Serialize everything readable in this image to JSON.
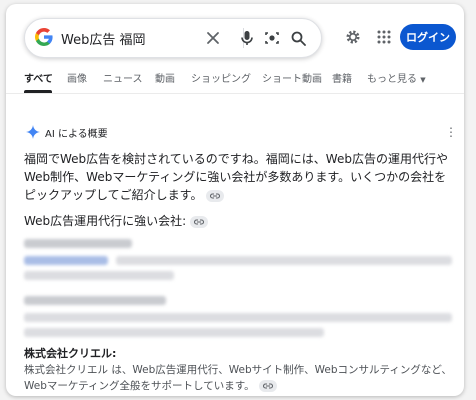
{
  "search": {
    "query": "Web広告 福岡"
  },
  "header": {
    "login_label": "ログイン"
  },
  "tabs": [
    {
      "label": "すべて",
      "active": true
    },
    {
      "label": "画像"
    },
    {
      "label": "ニュース"
    },
    {
      "label": "動画"
    },
    {
      "label": "ショッピング"
    },
    {
      "label": "ショート動画"
    },
    {
      "label": "書籍"
    },
    {
      "label": "もっと見る"
    }
  ],
  "ai_overview": {
    "label": "AI による概要",
    "intro": "福岡でWeb広告を検討されているのですね。福岡には、Web広告の運用代行やWeb制作、Webマーケティングに強い会社が多数あります。いくつかの会社をピックアップしてご紹介します。",
    "section_heading": "Web広告運用代行に強い会社:",
    "company_name": "株式会社クリエル:",
    "company_desc": "株式会社クリエル は、Web広告運用代行、Webサイト制作、Webコンサルティングなど、Webマーケティング全般をサポートしています。"
  },
  "colors": {
    "accent": "#0b57d0",
    "ai_star": "#4285f4"
  }
}
